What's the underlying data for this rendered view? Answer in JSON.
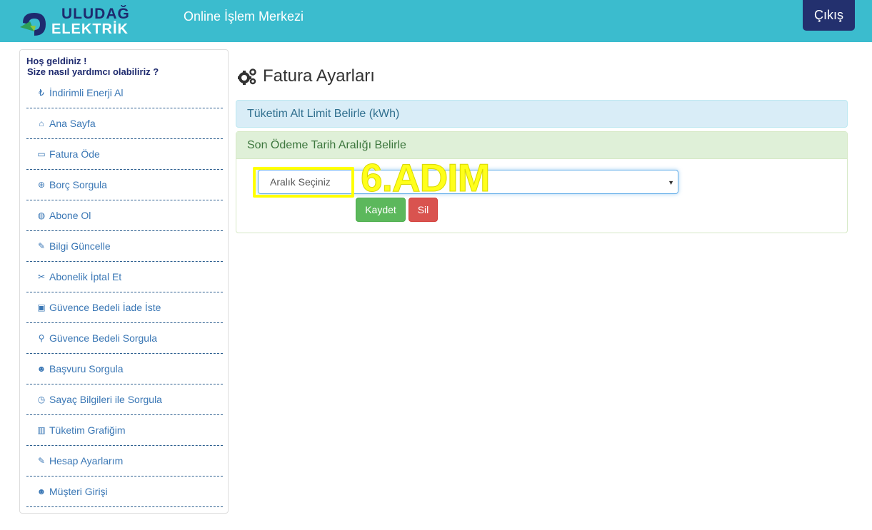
{
  "header": {
    "logo_line1": "ULUDAĞ",
    "logo_line2": "ELEKTRİK",
    "title": "Online İşlem Merkezi",
    "logout_label": "Çıkış",
    "bar_color": "#3bbcce"
  },
  "sidebar": {
    "welcome_line1": "Hoş geldiniz !",
    "welcome_line2": "Size nasıl yardımcı olabiliriz ?",
    "items": [
      {
        "icon": "lira-icon",
        "glyph": "₺",
        "label": "İndirimli Enerji Al"
      },
      {
        "icon": "home-icon",
        "glyph": "⌂",
        "label": "Ana Sayfa"
      },
      {
        "icon": "credit-card-icon",
        "glyph": "▭",
        "label": "Fatura Öde"
      },
      {
        "icon": "search-plus-icon",
        "glyph": "⊕",
        "label": "Borç Sorgula"
      },
      {
        "icon": "globe-icon",
        "glyph": "◍",
        "label": "Abone Ol"
      },
      {
        "icon": "edit-icon",
        "glyph": "✎",
        "label": "Bilgi Güncelle"
      },
      {
        "icon": "scissors-icon",
        "glyph": "✂",
        "label": "Abonelik İptal Et"
      },
      {
        "icon": "money-icon",
        "glyph": "▣",
        "label": "Güvence Bedeli İade İste"
      },
      {
        "icon": "search-icon",
        "glyph": "⚲",
        "label": "Güvence Bedeli Sorgula"
      },
      {
        "icon": "user-plus-icon",
        "glyph": "☻",
        "label": "Başvuru Sorgula"
      },
      {
        "icon": "clock-icon",
        "glyph": "◷",
        "label": "Sayaç Bilgileri ile Sorgula"
      },
      {
        "icon": "bar-chart-icon",
        "glyph": "▥",
        "label": "Tüketim Grafiğim"
      },
      {
        "icon": "edit-icon",
        "glyph": "✎",
        "label": "Hesap Ayarlarım"
      },
      {
        "icon": "users-icon",
        "glyph": "☻",
        "label": "Müşteri Girişi"
      }
    ]
  },
  "main": {
    "page_title": "Fatura Ayarları",
    "panel_info_title": "Tüketim Alt Limit Belirle (kWh)",
    "panel_success_title": "Son Ödeme Tarih Aralığı Belirle",
    "select_value": "Aralık Seçiniz",
    "step_annotation": "6.ADIM",
    "save_label": "Kaydet",
    "delete_label": "Sil"
  }
}
